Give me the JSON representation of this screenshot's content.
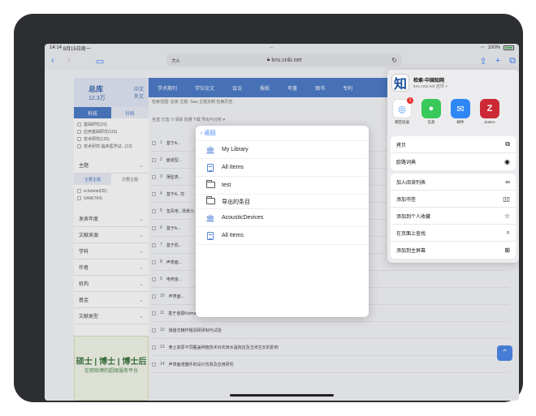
{
  "status": {
    "time": "14:14",
    "date": "8月15日周一",
    "dots": "···",
    "battery_text": "100%"
  },
  "browser": {
    "url": "kns.cnki.net",
    "text_size": "大A",
    "dots": "···"
  },
  "left_panel": {
    "title": "总库",
    "count": "12.3万",
    "lang_zh": "中文",
    "lang_en": "外文",
    "tab_active": "科技",
    "tab_other": "社科",
    "items": [
      "基础研究(20)",
      "应用基础研究(115)",
      "技术研究(126)",
      "技术研究-临床医学试...(13)"
    ],
    "facets": [
      "主题",
      "发表年度",
      "文献来源",
      "学科",
      "作者",
      "机构",
      "基金",
      "文献类型"
    ],
    "topic_tabs": [
      "主要主题",
      "次要主题"
    ],
    "topic_items": [
      "w.hetetel(35)",
      "SAW(764)"
    ],
    "ad_line1": "硕士 | 博士 | 博士后",
    "ad_line2": "在职硕博的超级服务平台"
  },
  "top_nav": [
    "学术期刊",
    "学位论文",
    "会议",
    "报纸",
    "年鉴",
    "图书",
    "专利"
  ],
  "filter_line": "检索范围: 总库  主题: Saw  主题定制  检索历史",
  "toolbar_line": "全选  已选: 0  清除  批量下载  导出与分析 ▾",
  "rows": [
    {
      "num": "1",
      "title": "基于A..."
    },
    {
      "num": "2",
      "title": "面递型..."
    },
    {
      "num": "3",
      "title": "薄型表..."
    },
    {
      "num": "4",
      "title": "基于A...究"
    },
    {
      "num": "5",
      "title": "急风电...场景分..."
    },
    {
      "num": "6",
      "title": "基于A..."
    },
    {
      "num": "7",
      "title": "基于机..."
    },
    {
      "num": "8",
      "title": "声表面..."
    },
    {
      "num": "9",
      "title": "电喷金..."
    },
    {
      "num": "10",
      "title": "声表面..."
    },
    {
      "num": "11",
      "title": "基于谐振Kolmain滤波的SAW测温数据纠错方法"
    },
    {
      "num": "12",
      "title": "锡盘式精杆粗调研研制与试验"
    },
    {
      "num": "13",
      "title": "黄土高原不同覆盖种植技术对农田水温效应及玉米生长的影响"
    },
    {
      "num": "14",
      "title": "声表面波器件的设计仿真及应用研究"
    }
  ],
  "popup": {
    "back": "返回",
    "items": [
      {
        "icon": "library-icon",
        "label": "My Library"
      },
      {
        "icon": "document-icon",
        "label": "All Items"
      },
      {
        "icon": "folder-icon",
        "label": "test"
      },
      {
        "icon": "folder-icon",
        "label": "导出的条目"
      },
      {
        "icon": "library-icon",
        "label": "AcousticDevices"
      },
      {
        "icon": "document-icon",
        "label": "All Items"
      }
    ]
  },
  "share": {
    "app_title": "检索-中国知网",
    "app_sub": "kns.cnki.net  选项 >",
    "apps": [
      {
        "name": "隔空投送",
        "color": "#3a8ef6"
      },
      {
        "name": "信息",
        "color": "#39c85a"
      },
      {
        "name": "邮件",
        "color": "#2f86f5"
      },
      {
        "name": "Zotero",
        "color": "#cc2936"
      }
    ],
    "airdrop_badge": "1",
    "group1": [
      {
        "label": "拷贝",
        "icon": "copy-icon"
      },
      {
        "label": "欧路词典",
        "icon": "dict-icon"
      }
    ],
    "group2": [
      {
        "label": "加入阅读列表",
        "icon": "glasses-icon"
      },
      {
        "label": "添加书签",
        "icon": "book-icon"
      },
      {
        "label": "添加到个人收藏",
        "icon": "star-icon"
      },
      {
        "label": "在页面上查找",
        "icon": "search-icon"
      },
      {
        "label": "添加到主屏幕",
        "icon": "add-square-icon"
      }
    ]
  }
}
